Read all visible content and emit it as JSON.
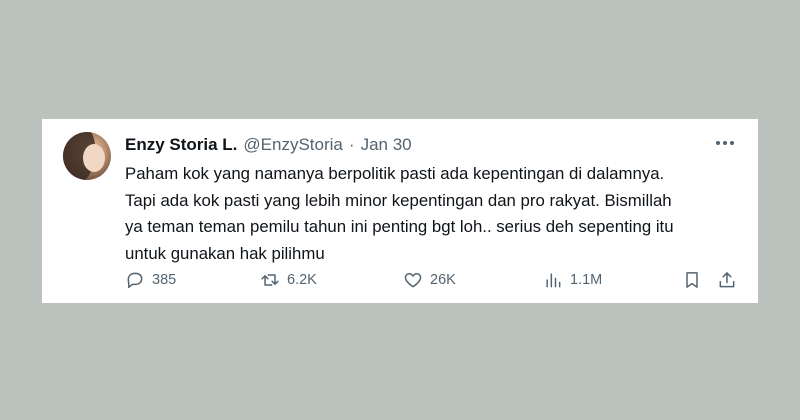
{
  "tweet": {
    "author_name": "Enzy Storia L.",
    "handle": "@EnzyStoria",
    "separator": "·",
    "date": "Jan 30",
    "lines": [
      "Paham kok yang namanya berpolitik pasti ada kepentingan di dalamnya.",
      "Tapi ada kok pasti yang lebih minor kepentingan dan pro rakyat. Bismillah",
      "ya teman teman pemilu tahun ini penting bgt loh.. serius deh sepenting itu",
      "untuk gunakan hak pilihmu"
    ]
  },
  "actions": {
    "replies": "385",
    "retweets": "6.2K",
    "likes": "26K",
    "views": "1.1M"
  },
  "icons": [
    "reply-icon",
    "retweet-icon",
    "like-icon",
    "views-icon",
    "bookmark-icon",
    "share-icon",
    "more-icon"
  ],
  "colors": {
    "background": "#bcc2bd",
    "card": "#ffffff",
    "text": "#0f1419",
    "muted": "#536471"
  }
}
